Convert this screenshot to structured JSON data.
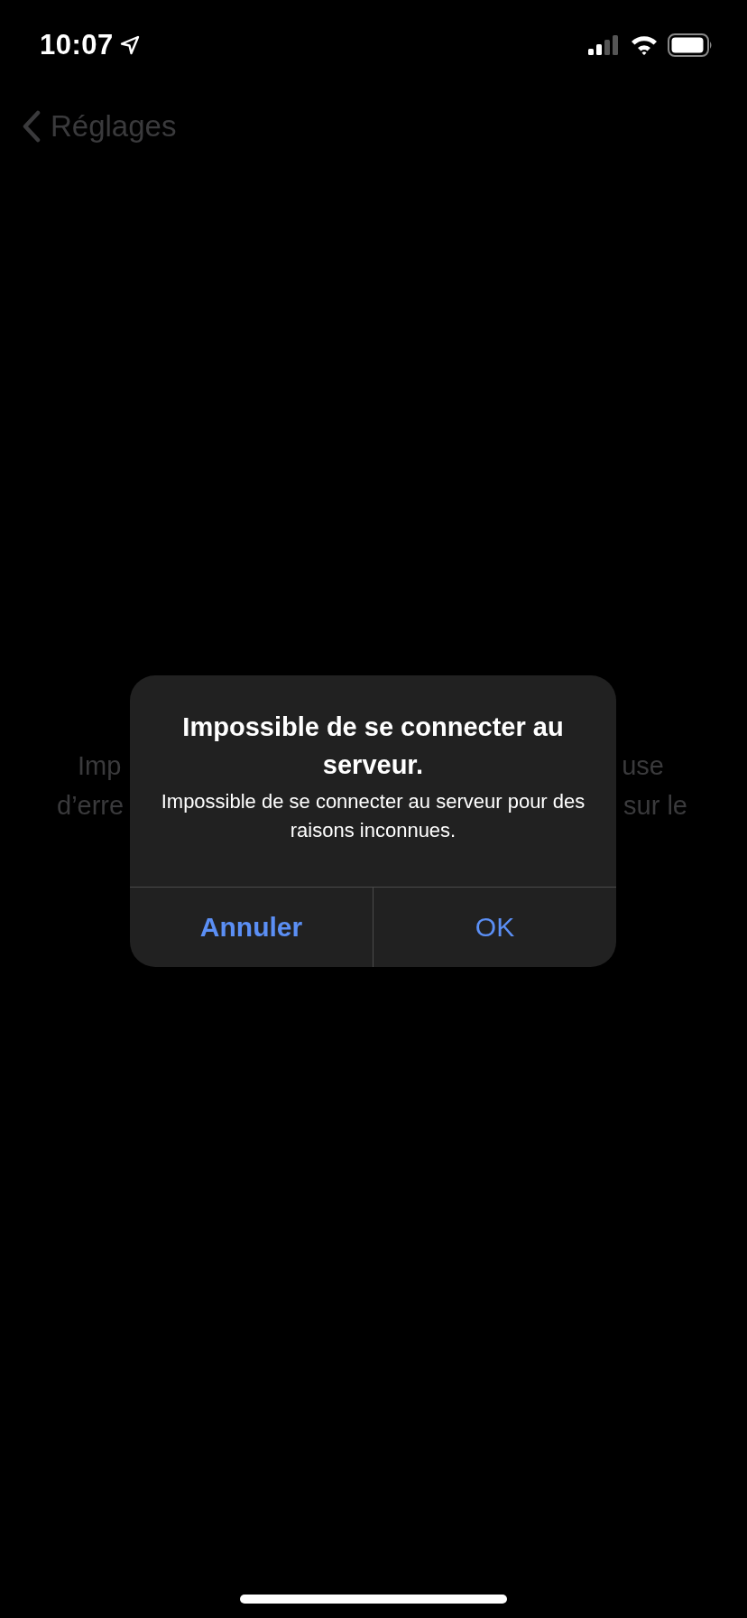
{
  "status_bar": {
    "time": "10:07"
  },
  "nav": {
    "back_label": "Réglages"
  },
  "background_text": {
    "lines": [
      {
        "left": "Imp",
        "right": "use"
      },
      {
        "left": "d’erre",
        "right": "sur le"
      }
    ]
  },
  "alert": {
    "title": "Impossible de se connecter au serveur.",
    "message": "Impossible de se connecter au serveur pour des raisons inconnues.",
    "buttons": [
      {
        "label": "Annuler",
        "kind": "bold"
      },
      {
        "label": "OK",
        "kind": "regular"
      }
    ]
  }
}
